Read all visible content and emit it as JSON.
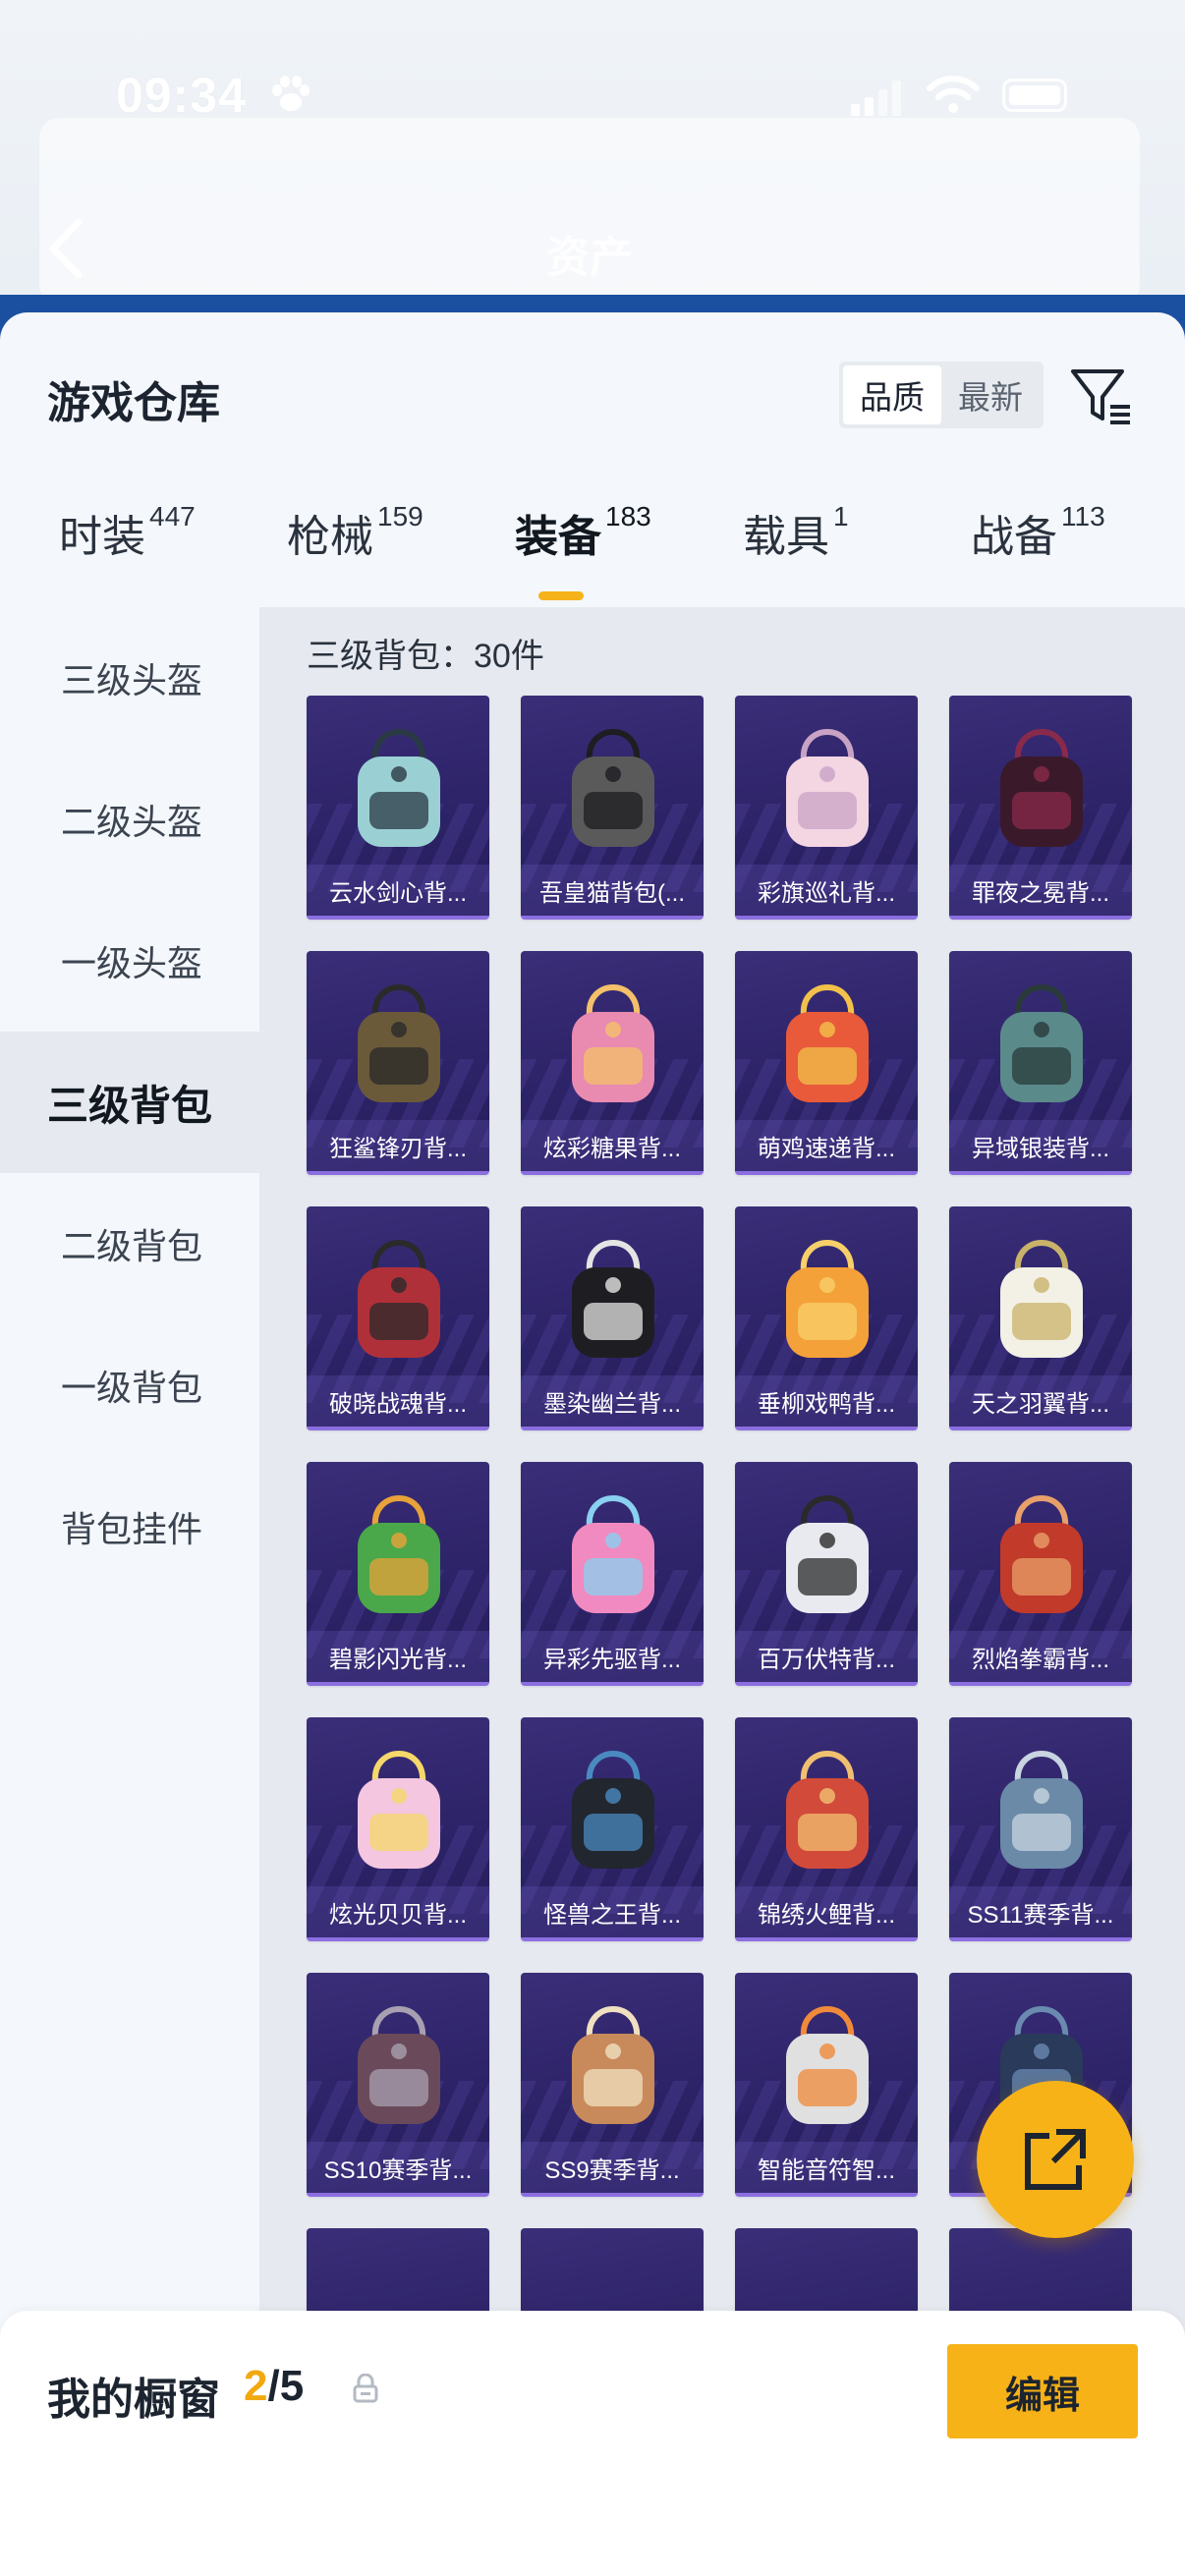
{
  "status_bar": {
    "time": "09:34"
  },
  "background": {
    "title": "资产"
  },
  "sheet": {
    "title": "游戏仓库",
    "sort": {
      "options": [
        "品质",
        "最新"
      ],
      "selected": "品质"
    },
    "tabs": [
      {
        "label": "时装",
        "count": "447"
      },
      {
        "label": "枪械",
        "count": "159"
      },
      {
        "label": "装备",
        "count": "183"
      },
      {
        "label": "载具",
        "count": "1"
      },
      {
        "label": "战备",
        "count": "113"
      }
    ],
    "active_tab": "装备",
    "sidebar": [
      {
        "label": "三级头盔"
      },
      {
        "label": "二级头盔"
      },
      {
        "label": "一级头盔"
      },
      {
        "label": "三级背包"
      },
      {
        "label": "二级背包"
      },
      {
        "label": "一级背包"
      },
      {
        "label": "背包挂件"
      }
    ],
    "active_sidebar": "三级背包",
    "section_label": "三级背包：30件",
    "items": [
      {
        "name": "云水剑心背..."
      },
      {
        "name": "吾皇猫背包(..."
      },
      {
        "name": "彩旗巡礼背..."
      },
      {
        "name": "罪夜之冕背..."
      },
      {
        "name": "狂鲨锋刃背..."
      },
      {
        "name": "炫彩糖果背..."
      },
      {
        "name": "萌鸡速递背..."
      },
      {
        "name": "异域银装背..."
      },
      {
        "name": "破晓战魂背..."
      },
      {
        "name": "墨染幽兰背..."
      },
      {
        "name": "垂柳戏鸭背..."
      },
      {
        "name": "天之羽翼背..."
      },
      {
        "name": "碧影闪光背..."
      },
      {
        "name": "异彩先驱背..."
      },
      {
        "name": "百万伏特背..."
      },
      {
        "name": "烈焰拳霸背..."
      },
      {
        "name": "炫光贝贝背..."
      },
      {
        "name": "怪兽之王背..."
      },
      {
        "name": "锦绣火鲤背..."
      },
      {
        "name": "SS11赛季背..."
      },
      {
        "name": "SS10赛季背..."
      },
      {
        "name": "SS9赛季背..."
      },
      {
        "name": "智能音符智..."
      },
      {
        "name": ""
      }
    ]
  },
  "bottom_bar": {
    "label": "我的橱窗",
    "current": "2",
    "total": "/5",
    "edit_label": "编辑"
  },
  "colors": {
    "accent": "#f7b217",
    "card_bg": "#2d2368",
    "sidebar_active_bg": "#e6eaf0"
  }
}
